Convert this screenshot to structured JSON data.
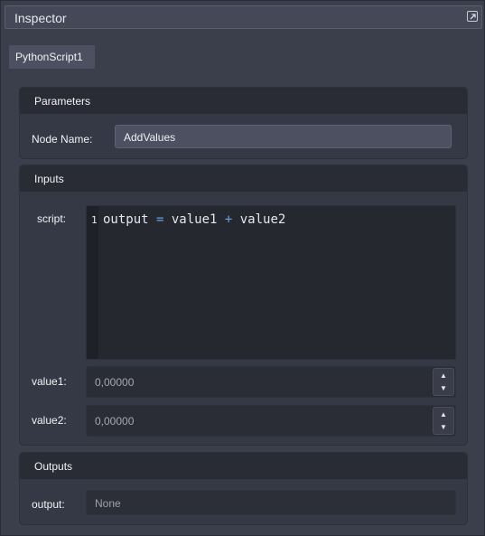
{
  "inspector": {
    "title": "Inspector",
    "icons": {
      "popout": "popout-window-icon"
    }
  },
  "node_tab": {
    "label": "PythonScript1"
  },
  "parameters": {
    "title": "Parameters",
    "node_name_label": "Node Name:",
    "node_name_value": "AddValues"
  },
  "inputs": {
    "title": "Inputs",
    "script_label": "script:",
    "script_line_number": "1",
    "script_code": {
      "t1": "output ",
      "op1": "=",
      "t2": " value1 ",
      "op2": "+",
      "t3": " value2"
    },
    "value1_label": "value1:",
    "value1_value": "0,00000",
    "value2_label": "value2:",
    "value2_value": "0,00000",
    "spin_up_glyph": "▲",
    "spin_down_glyph": "▼"
  },
  "outputs": {
    "title": "Outputs",
    "output_label": "output:",
    "output_value": "None"
  },
  "colors": {
    "panel_bg": "#3b3e4b",
    "group_bg": "#353845",
    "header_bg": "#2a2c35",
    "operator_accent": "#5ea6e8"
  }
}
